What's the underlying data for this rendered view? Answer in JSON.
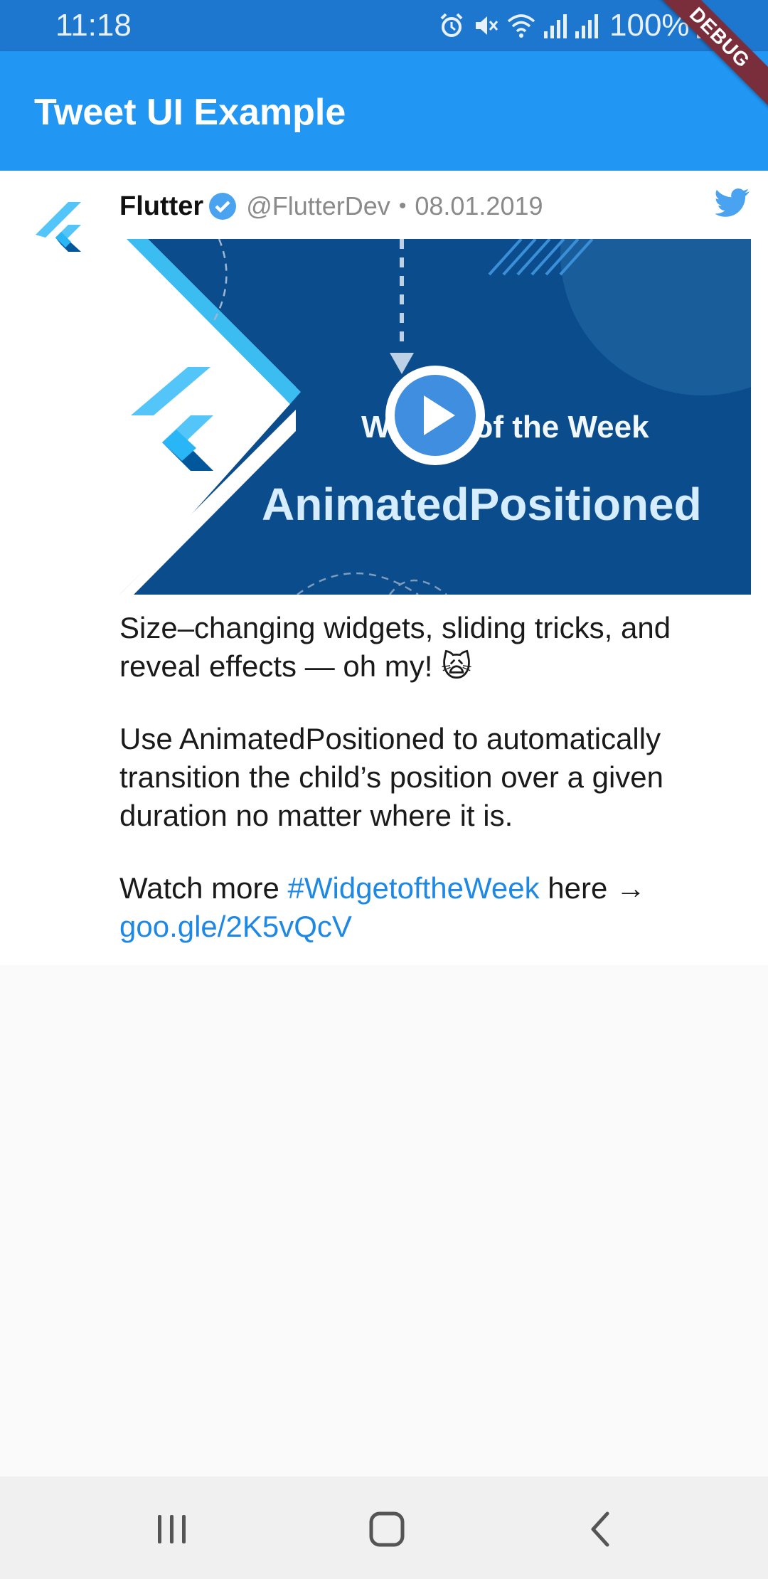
{
  "status_bar": {
    "time": "11:18",
    "battery": "100%",
    "icons": [
      "alarm-icon",
      "mute-icon",
      "wifi-icon",
      "signal-icon",
      "signal-icon",
      "battery-icon"
    ]
  },
  "app_bar": {
    "title": "Tweet UI Example"
  },
  "debug_banner": {
    "label": "DEBUG"
  },
  "tweet": {
    "author_name": "Flutter",
    "verified": true,
    "handle": "@FlutterDev",
    "separator": "•",
    "date": "08.01.2019",
    "media": {
      "kind": "video",
      "overlay_title": "Widget of the Week",
      "overlay_subtitle": "AnimatedPositioned"
    },
    "text": {
      "para1": "Size–changing widgets, sliding tricks, and reveal effects — oh my! 🙀",
      "para2": "Use AnimatedPositioned to automatically transition the child’s position over a given duration no matter where it is.",
      "para3_prefix": "Watch more ",
      "hashtag": "#WidgetoftheWeek",
      "para3_mid": " here →",
      "url": "goo.gle/2K5vQcV"
    }
  },
  "colors": {
    "status_bar": "#1e77cf",
    "app_bar": "#2196f3",
    "link": "#1e88e5",
    "media_bg": "#0b4d8c",
    "debug_banner": "#7a2e3b"
  },
  "nav_bar": {
    "buttons": [
      "recents-icon",
      "home-icon",
      "back-icon"
    ]
  }
}
